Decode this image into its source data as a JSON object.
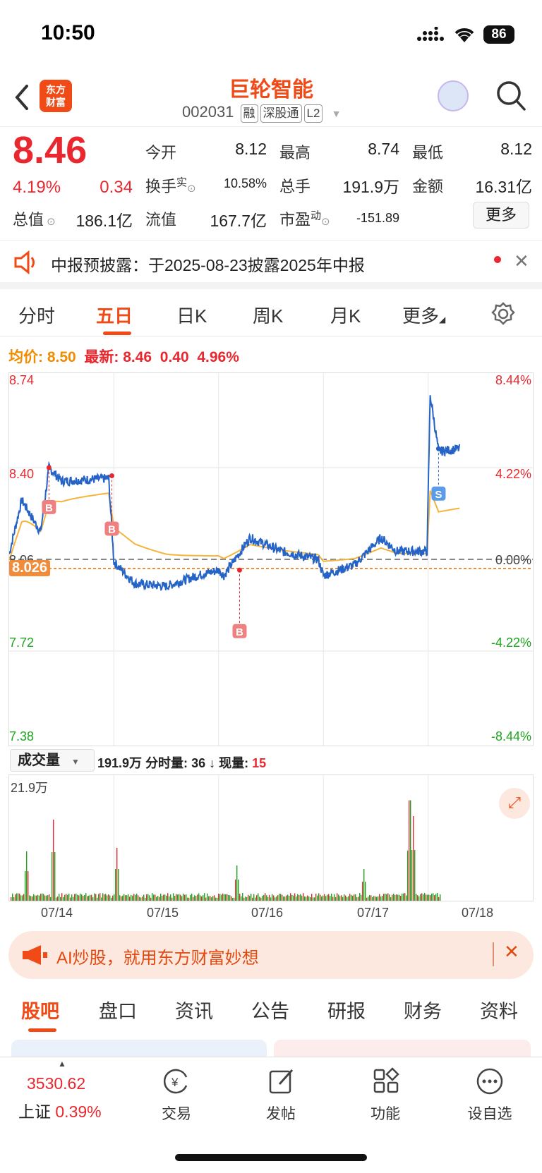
{
  "status": {
    "time": "10:50",
    "battery": "86"
  },
  "header": {
    "title": "巨轮智能",
    "code": "002031",
    "tags": [
      "融",
      "深股通",
      "L2"
    ]
  },
  "quote": {
    "price": "8.46",
    "change_pct": "4.19%",
    "change": "0.34",
    "open_label": "今开",
    "open": "8.12",
    "high_label": "最高",
    "high": "8.74",
    "low_label": "最低",
    "low": "8.12",
    "turnover_label": "换手",
    "turnover_sup": "实",
    "turnover": "10.58%",
    "volume_label": "总手",
    "volume": "191.9万",
    "amount_label": "金额",
    "amount": "16.31亿",
    "mktcap_label": "总值",
    "mktcap": "186.1亿",
    "float_label": "流值",
    "float": "167.7亿",
    "pe_label": "市盈",
    "pe_sup": "动",
    "pe": "-151.89",
    "more": "更多"
  },
  "notice": {
    "text": "中报预披露：于2025-08-23披露2025年中报"
  },
  "tabs": [
    "分时",
    "五日",
    "日K",
    "周K",
    "月K",
    "更多"
  ],
  "active_tab": "五日",
  "chart_info": {
    "avg_label": "均价:",
    "avg": "8.50",
    "latest_label": "最新:",
    "latest": "8.46",
    "chg": "0.40",
    "chg_pct": "4.96%"
  },
  "chart_data": {
    "type": "line",
    "series": [
      {
        "name": "均价"
      }
    ],
    "y_labels": [
      "8.74",
      "8.40",
      "8.06",
      "7.72",
      "7.38"
    ],
    "pct_labels": [
      "8.44%",
      "4.22%",
      "0.00%",
      "-4.22%",
      "-8.44%"
    ],
    "ref_line": "8.026",
    "x_labels": [
      "07/14",
      "07/15",
      "07/16",
      "07/17",
      "07/18"
    ],
    "ylim": [
      7.38,
      8.74
    ],
    "markers": [
      "B",
      "B",
      "B",
      "S"
    ]
  },
  "volume": {
    "selector": "成交量",
    "total": "191.9万",
    "tick_label": "分时量:",
    "tick": "36",
    "now_label": "现量:",
    "now": "15",
    "max": "21.9万"
  },
  "ai_banner": {
    "text": "AI炒股，就用东方财富妙想"
  },
  "bottom_tabs": [
    "股吧",
    "盘口",
    "资讯",
    "公告",
    "研报",
    "财务",
    "资料"
  ],
  "tabbar": {
    "index_value": "3530.62",
    "index_name": "上证",
    "index_pct": "0.39%",
    "items": [
      "交易",
      "发帖",
      "功能",
      "设自选"
    ]
  },
  "colors": {
    "accent": "#f04a16",
    "up": "#e8272e",
    "down": "#1ea51e",
    "avg": "#f5b43c",
    "price_line": "#2563c7"
  }
}
